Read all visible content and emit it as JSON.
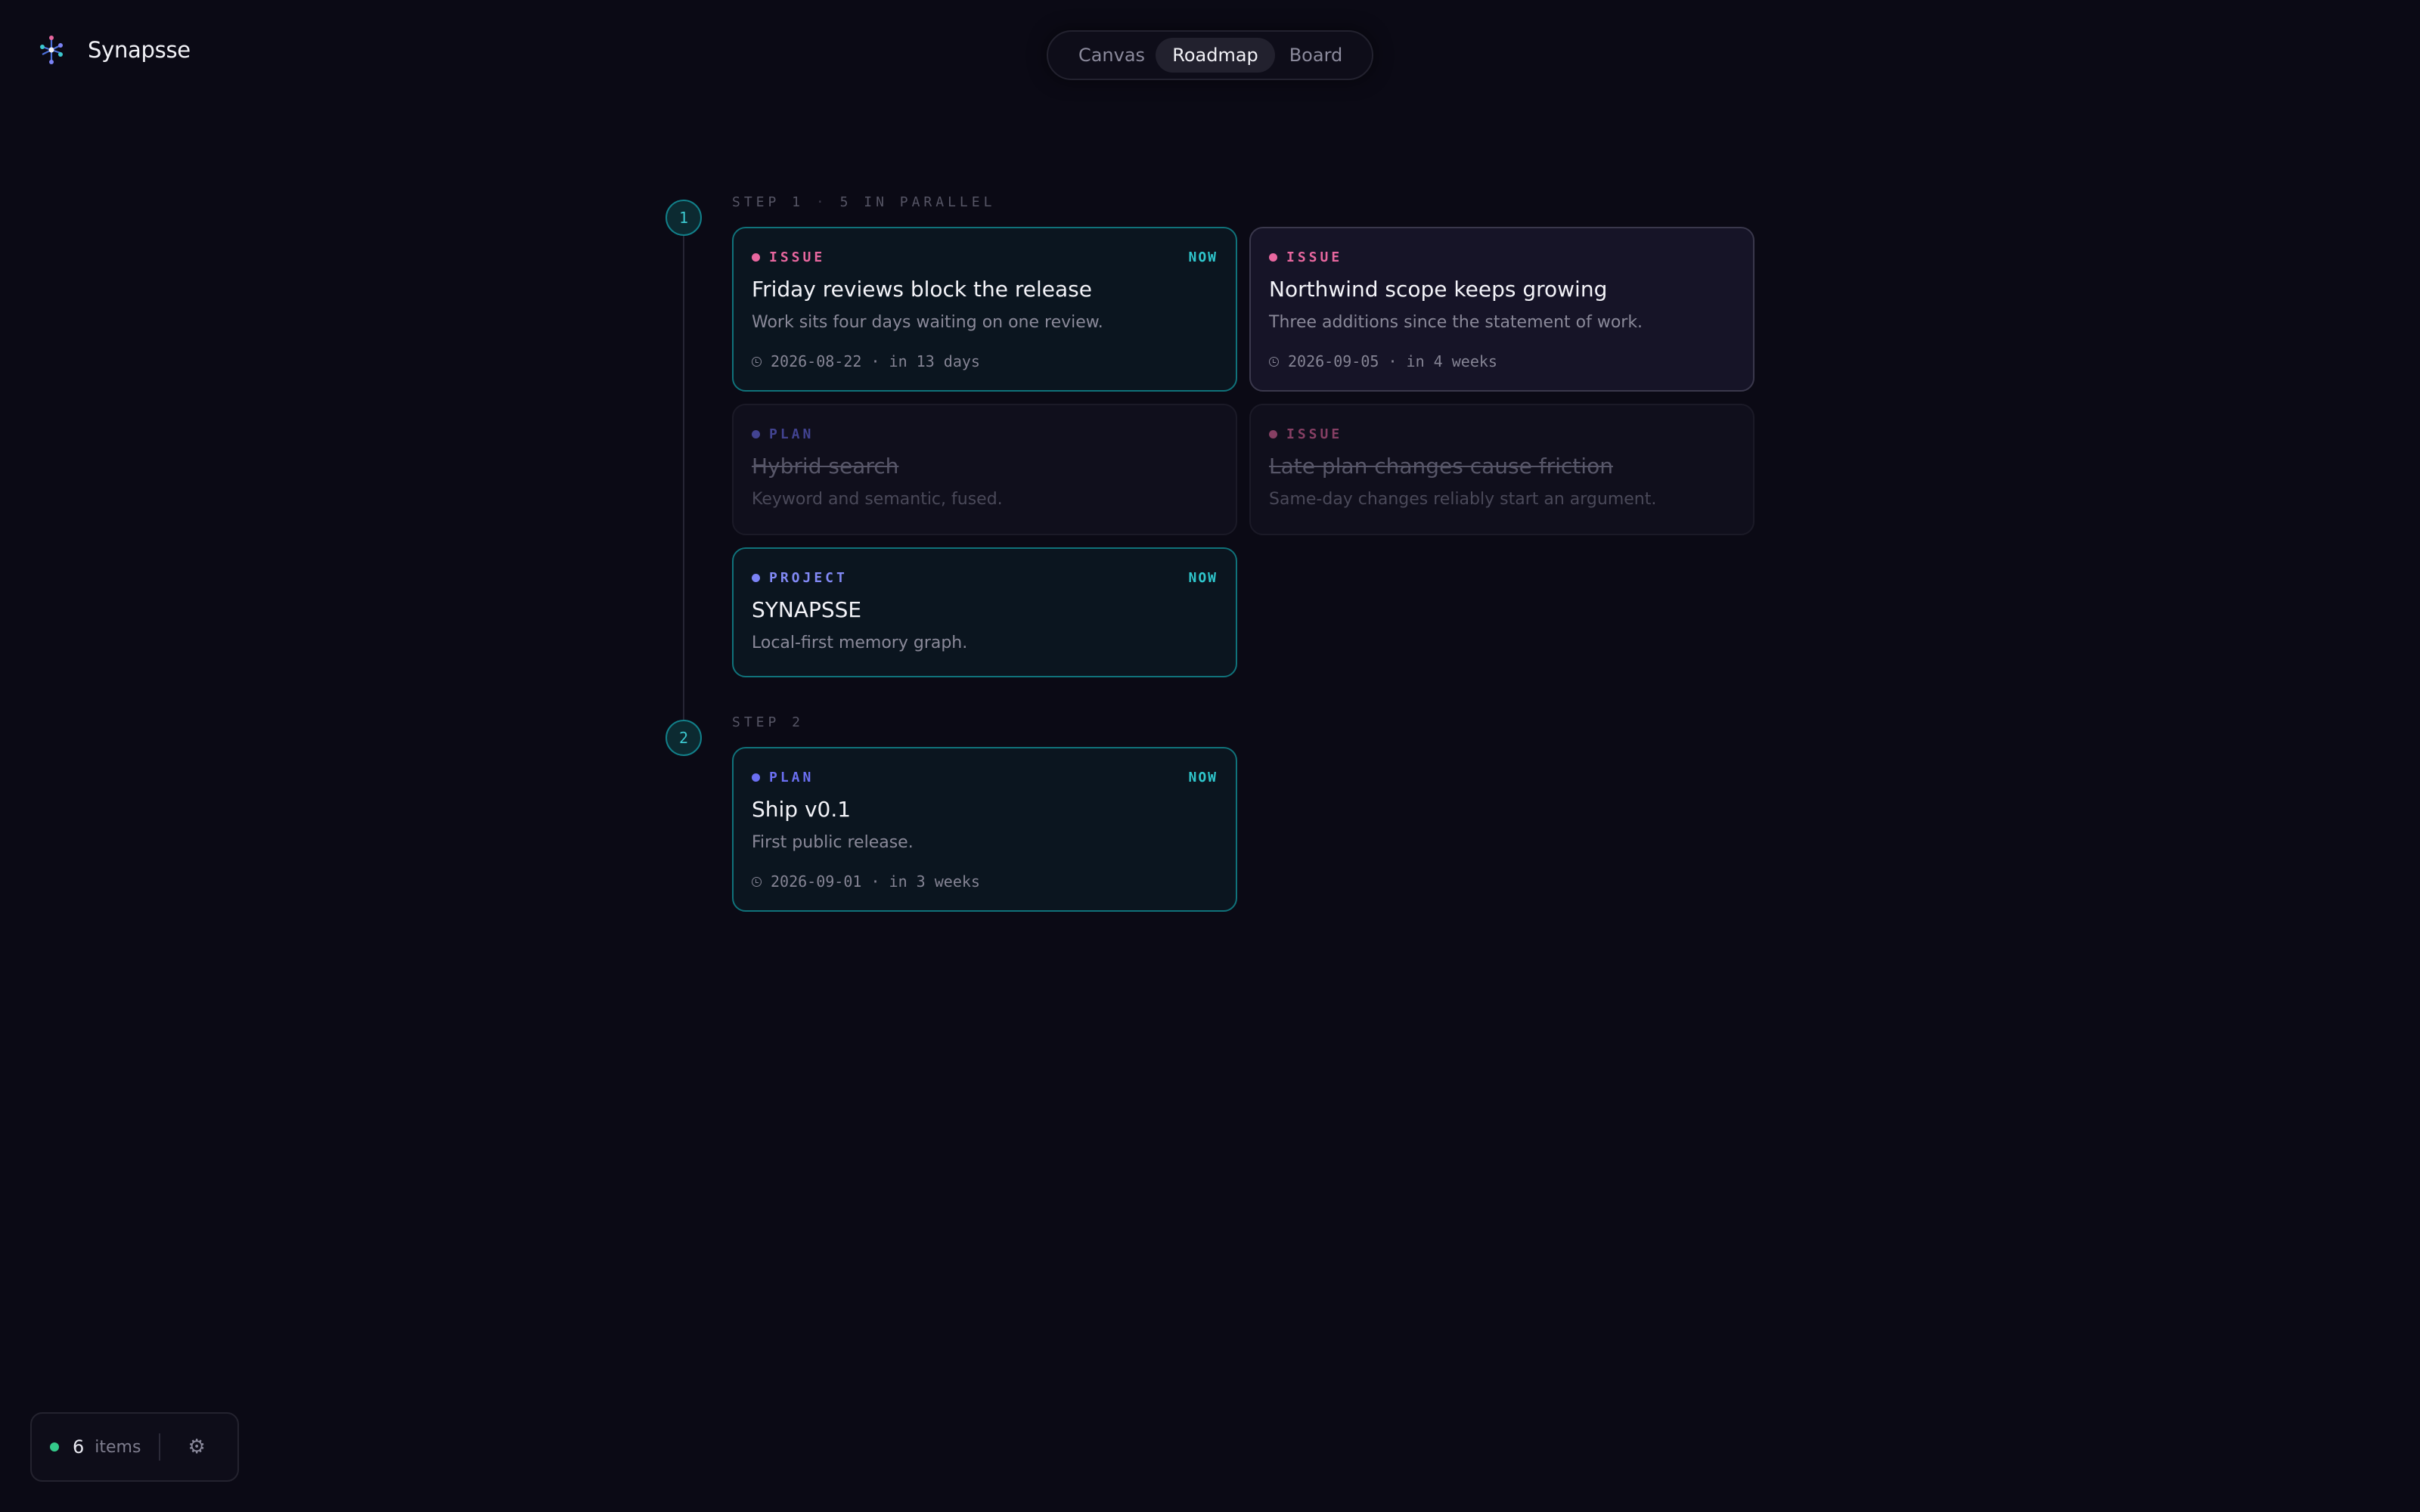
{
  "app": {
    "name": "Synapsse",
    "logo_icon": "constellation-logo-icon"
  },
  "views": {
    "tabs": [
      {
        "label": "Canvas",
        "active": false
      },
      {
        "label": "Roadmap",
        "active": true
      },
      {
        "label": "Board",
        "active": false
      }
    ]
  },
  "steps": [
    {
      "number": "1",
      "label": "STEP 1",
      "detail": "5 IN PARALLEL",
      "cards": [
        {
          "kind": "ISSUE",
          "kind_color": "#e8679f",
          "now": "NOW",
          "title": "Friday reviews block the release",
          "description": "Work sits four days waiting on one review.",
          "date": "2026-08-22",
          "relative": "in 13 days",
          "state": "active"
        },
        {
          "kind": "ISSUE",
          "kind_color": "#e8679f",
          "now": "",
          "title": "Northwind scope keeps growing",
          "description": "Three additions since the statement of work.",
          "date": "2026-09-05",
          "relative": "in 4 weeks",
          "state": "default"
        },
        {
          "kind": "PLAN",
          "kind_color": "#6b6ff2",
          "now": "",
          "title": "Hybrid search",
          "description": "Keyword and semantic, fused.",
          "state": "done"
        },
        {
          "kind": "ISSUE",
          "kind_color": "#e8679f",
          "now": "",
          "title": "Late plan changes cause friction",
          "description": "Same-day changes reliably start an argument.",
          "state": "done"
        },
        {
          "kind": "PROJECT",
          "kind_color": "#7c83f6",
          "now": "NOW",
          "title": "SYNAPSSE",
          "description": "Local-first memory graph.",
          "state": "active"
        }
      ]
    },
    {
      "number": "2",
      "label": "STEP 2",
      "detail": "",
      "cards": [
        {
          "kind": "PLAN",
          "kind_color": "#6b6ff2",
          "now": "NOW",
          "title": "Ship v0.1",
          "description": "First public release.",
          "date": "2026-09-01",
          "relative": "in 3 weeks",
          "state": "active"
        }
      ]
    }
  ],
  "status": {
    "count": "6",
    "label": "items",
    "indicator_color": "#34c98a",
    "settings_icon": "gear-icon"
  }
}
